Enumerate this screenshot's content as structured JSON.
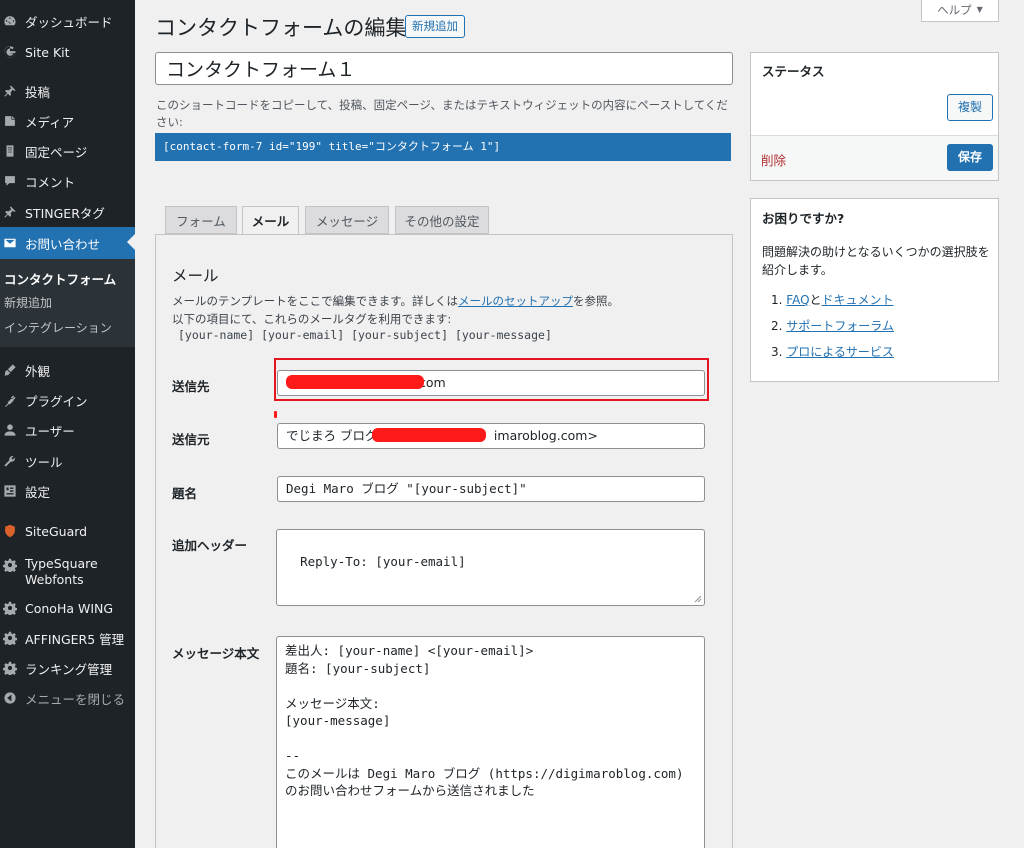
{
  "sidebar": {
    "items": [
      {
        "label": "ダッシュボード",
        "icon": "dashboard-icon"
      },
      {
        "label": "Site Kit",
        "icon": "google-g-icon"
      },
      {
        "label": "投稿",
        "icon": "pin-icon"
      },
      {
        "label": "メディア",
        "icon": "media-icon"
      },
      {
        "label": "固定ページ",
        "icon": "page-icon"
      },
      {
        "label": "コメント",
        "icon": "comment-icon"
      },
      {
        "label": "STINGERタグ",
        "icon": "pin-icon"
      },
      {
        "label": "お問い合わせ",
        "icon": "mail-icon"
      },
      {
        "label": "外観",
        "icon": "brush-icon"
      },
      {
        "label": "プラグイン",
        "icon": "plugin-icon"
      },
      {
        "label": "ユーザー",
        "icon": "user-icon"
      },
      {
        "label": "ツール",
        "icon": "wrench-icon"
      },
      {
        "label": "設定",
        "icon": "settings-icon"
      },
      {
        "label": "SiteGuard",
        "icon": "shield-icon"
      },
      {
        "label": "TypeSquare Webfonts",
        "icon": "gear-icon"
      },
      {
        "label": "ConoHa WING",
        "icon": "gear-icon"
      },
      {
        "label": "AFFINGER5 管理",
        "icon": "gear-icon"
      },
      {
        "label": "ランキング管理",
        "icon": "gear-icon"
      },
      {
        "label": "メニューを閉じる",
        "icon": "collapse-icon"
      }
    ],
    "submenu": [
      "コンタクトフォーム",
      "新規追加",
      "インテグレーション"
    ]
  },
  "header": {
    "title": "コンタクトフォームの編集",
    "add_new": "新規追加",
    "help": "ヘルプ"
  },
  "form": {
    "title_value": "コンタクトフォーム１",
    "shortcode_desc": "このショートコードをコピーして、投稿、固定ページ、またはテキストウィジェットの内容にペーストしてください:",
    "shortcode": "[contact-form-7 id=\"199\" title=\"コンタクトフォーム 1\"]"
  },
  "tabs": [
    "フォーム",
    "メール",
    "メッセージ",
    "その他の設定"
  ],
  "mail": {
    "heading": "メール",
    "desc1_prefix": "メールのテンプレートをここで編集できます。詳しくは",
    "desc1_link": "メールのセットアップ",
    "desc1_suffix": "を参照。",
    "desc2": "以下の項目にて、これらのメールタグを利用できます:",
    "tags": "[your-name] [your-email] [your-subject] [your-message]",
    "to_label": "送信先",
    "to_value": "com",
    "from_label": "送信元",
    "from_value_prefix": "でじまろ ブログ <",
    "from_value_suffix": "imaroblog.com>",
    "subject_label": "題名",
    "subject_value": "Degi Maro ブログ \"[your-subject]\"",
    "headers_label": "追加ヘッダー",
    "headers_value": "Reply-To: [your-email]",
    "body_label": "メッセージ本文",
    "body_value": "差出人: [your-name] <[your-email]>\n題名: [your-subject]\n\nメッセージ本文:\n[your-message]\n\n-- \nこのメールは Degi Maro ブログ (https://digimaroblog.com) のお問い合わせフォームから送信されました"
  },
  "status_box": {
    "title": "ステータス",
    "duplicate": "複製",
    "delete": "削除",
    "save": "保存"
  },
  "help_box": {
    "title": "お困りですか?",
    "line1": "問題解決の助けとなるいくつかの選択肢を",
    "line2": "紹介します。",
    "items": [
      {
        "num": "1.",
        "link1": "FAQ",
        "mid": "と",
        "link2": "ドキュメント"
      },
      {
        "num": "2.",
        "link1": "サポートフォーラム"
      },
      {
        "num": "3.",
        "link1": "プロによるサービス"
      }
    ]
  },
  "colors": {
    "accent": "#2271b1",
    "sidebar_bg": "#1d2327",
    "highlight": "#e3161f",
    "redaction": "#ff1a1a"
  }
}
